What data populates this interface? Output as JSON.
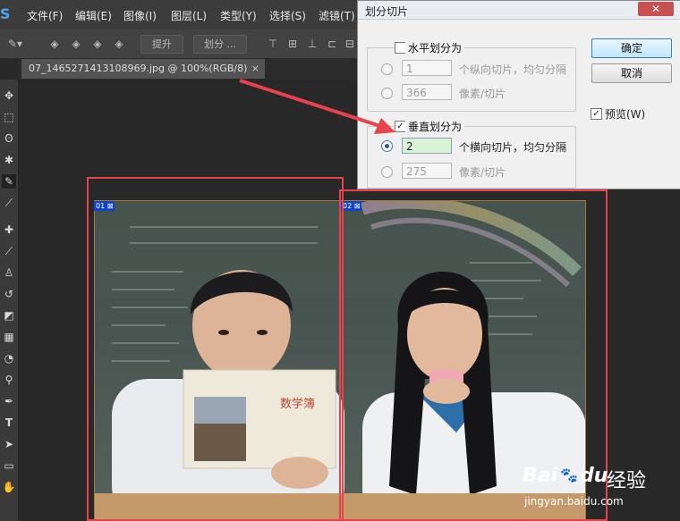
{
  "app": {
    "logo": "S"
  },
  "menu": [
    "文件(F)",
    "编辑(E)",
    "图像(I)",
    "图层(L)",
    "类型(Y)",
    "选择(S)",
    "滤镜(T)"
  ],
  "options_bar": {
    "promote_label": "提升",
    "divide_label": "划分 ..."
  },
  "document": {
    "tab_title": "07_1465271413108969.jpg @ 100%(RGB/8)",
    "close": "×"
  },
  "slices": [
    {
      "tag": "01"
    },
    {
      "tag": "02"
    }
  ],
  "dialog": {
    "title": "划分切片",
    "close_glyph": "✕",
    "horizontal": {
      "label": "水平划分为",
      "checked": false,
      "count": "1",
      "count_suffix": "个纵向切片，均匀分隔",
      "pixels": "366",
      "pixels_suffix": "像素/切片"
    },
    "vertical": {
      "label": "垂直划分为",
      "checked": true,
      "count": "2",
      "count_suffix": "个横向切片，均匀分隔",
      "pixels": "275",
      "pixels_suffix": "像素/切片"
    },
    "ok_label": "确定",
    "cancel_label": "取消",
    "preview_label": "预览(W)",
    "preview_checked": true
  },
  "photo": {
    "book_title": "数学簿"
  },
  "watermark": {
    "brand": "Bai",
    "brand2": "du",
    "product": "经验",
    "url": "jingyan.baidu.com"
  },
  "colors": {
    "annotation_red": "#e8434d",
    "ps_blue": "#4ea6e8",
    "slice_tag": "#1144cc"
  }
}
